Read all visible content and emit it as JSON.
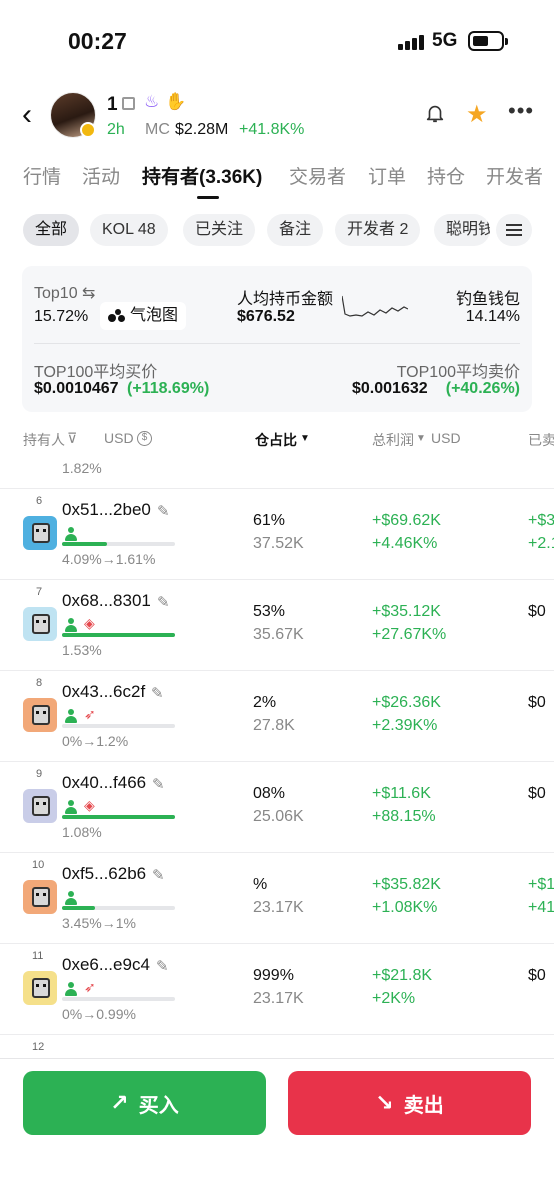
{
  "status": {
    "time": "00:27",
    "network": "5G"
  },
  "token": {
    "name": "1",
    "age": "2h",
    "mc_label": "MC",
    "mc_value": "$2.28M",
    "mc_change": "+41.8K%"
  },
  "tabs": [
    "行情",
    "活动",
    "持有者(3.36K)",
    "交易者",
    "订单",
    "持仓",
    "开发者"
  ],
  "active_tab": "持有者(3.36K)",
  "chips": [
    "全部",
    "KOL 48",
    "已关注",
    "备注",
    "开发者 2",
    "聪明钱"
  ],
  "stats": {
    "top10_label": "Top10 ⇆",
    "top10_value": "15.72%",
    "bubble_label": "气泡图",
    "avg_hold_label": "人均持币金额",
    "avg_hold_value": "$676.52",
    "phishing_label": "钓鱼钱包",
    "phishing_value": "14.14%",
    "top100_buy_label": "TOP100平均买价",
    "top100_buy_value": "$0.0010467",
    "top100_buy_change": "(+118.69%)",
    "top100_sell_label": "TOP100平均卖价",
    "top100_sell_value": "$0.001632",
    "top100_sell_change": "(+40.26%)"
  },
  "table": {
    "col_holder": "持有人",
    "col_usd": "USD",
    "col_position": "仓占比",
    "col_profit": "总利润",
    "col_profit_unit": "USD",
    "col_sold": "已卖",
    "prev_row_tail": "1.82%"
  },
  "rows": [
    {
      "rank": "6",
      "address": "0x51...2be0",
      "holding": "4.09%→1.61%",
      "bar_fraction": 0.4,
      "pct": "61%",
      "usd_held": "37.52K",
      "profit": "+$69.62K",
      "profit_pct": "+4.46K%",
      "sold": "+$3",
      "sold2": "+2.1",
      "extra_tag": "",
      "avatar_color": "#4fb0e0"
    },
    {
      "rank": "7",
      "address": "0x68...8301",
      "holding": "1.53%",
      "bar_fraction": 1.0,
      "pct": "53%",
      "usd_held": "35.67K",
      "profit": "+$35.12K",
      "profit_pct": "+27.67K%",
      "sold": "$0",
      "sold2": "",
      "extra_tag": "layers-icon",
      "avatar_color": "#bfe3f2"
    },
    {
      "rank": "8",
      "address": "0x43...6c2f",
      "holding": "0%→1.2%",
      "bar_fraction": 0.0,
      "pct": "2%",
      "usd_held": "27.8K",
      "profit": "+$26.36K",
      "profit_pct": "+2.39K%",
      "sold": "$0",
      "sold2": "",
      "extra_tag": "fish-icon",
      "avatar_color": "#f2a878"
    },
    {
      "rank": "9",
      "address": "0x40...f466",
      "holding": "1.08%",
      "bar_fraction": 1.0,
      "pct": "08%",
      "usd_held": "25.06K",
      "profit": "+$11.6K",
      "profit_pct": "+88.15%",
      "sold": "$0",
      "sold2": "",
      "extra_tag": "layers-icon",
      "avatar_color": "#c9cde8"
    },
    {
      "rank": "10",
      "address": "0xf5...62b6",
      "holding": "3.45%→1%",
      "bar_fraction": 0.29,
      "pct": "%",
      "usd_held": "23.17K",
      "profit": "+$35.82K",
      "profit_pct": "+1.08K%",
      "sold": "+$1",
      "sold2": "+41",
      "extra_tag": "",
      "avatar_color": "#f2a878"
    },
    {
      "rank": "11",
      "address": "0xe6...e9c4",
      "holding": "0%→0.99%",
      "bar_fraction": 0.0,
      "pct": "999%",
      "usd_held": "23.17K",
      "profit": "+$21.8K",
      "profit_pct": "+2K%",
      "sold": "$0",
      "sold2": "",
      "extra_tag": "fish-icon",
      "avatar_color": "#f5e08a"
    },
    {
      "rank": "12",
      "address": "",
      "holding": "",
      "bar_fraction": 0.0,
      "pct": "",
      "usd_held": "",
      "profit": "",
      "profit_pct": "",
      "sold": "",
      "sold2": "",
      "extra_tag": "",
      "avatar_color": "#ffffff"
    }
  ],
  "buttons": {
    "buy": "买入",
    "sell": "卖出"
  },
  "colors": {
    "green": "#2cb154",
    "red": "#e8334a",
    "star": "#f5a623"
  }
}
